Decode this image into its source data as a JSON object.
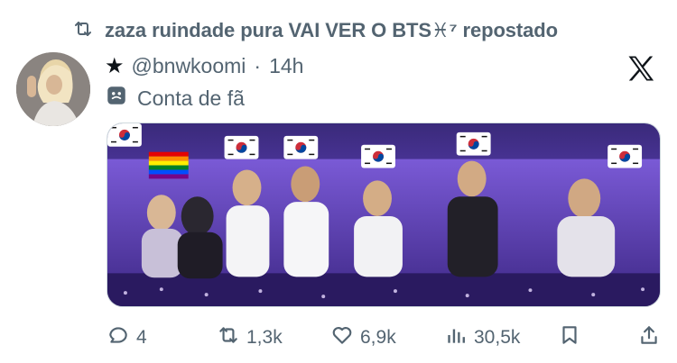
{
  "repost": {
    "text": "zaza ruindade pura VAI VER O BTS♓⁷ repostado",
    "icon": "repost-icon"
  },
  "tweet": {
    "star": "★",
    "handle": "@bnwkoomi",
    "separator": "·",
    "time": "14h",
    "fan_label": "Conta de fã",
    "fan_icon": "theater-masks-icon"
  },
  "actions": {
    "replies": "4",
    "reposts": "1,3k",
    "likes": "6,9k",
    "views": "30,5k"
  },
  "colors": {
    "text": "#0f1419",
    "secondary": "#536471",
    "border": "#cfd9de",
    "media_purple": "#6a3fc4"
  }
}
